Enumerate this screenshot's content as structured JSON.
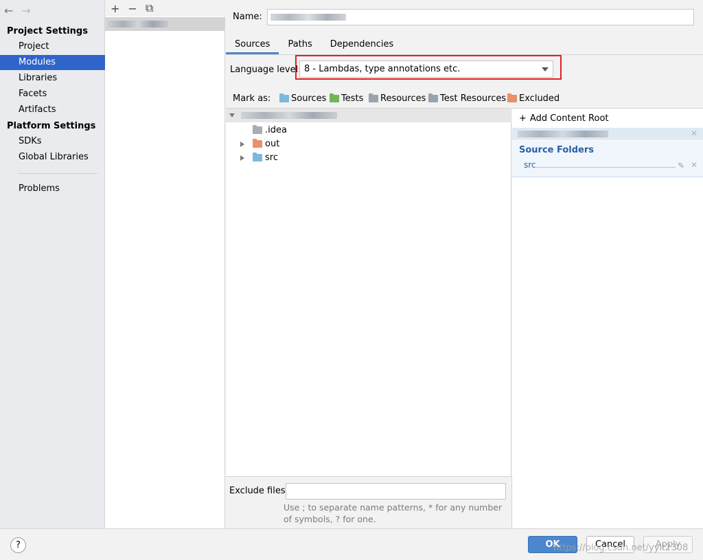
{
  "nav": {
    "back_icon": "←",
    "forward_icon": "→",
    "project_settings_title": "Project Settings",
    "project_settings_items": [
      "Project",
      "Modules",
      "Libraries",
      "Facets",
      "Artifacts"
    ],
    "platform_settings_title": "Platform Settings",
    "platform_settings_items": [
      "SDKs",
      "Global Libraries"
    ],
    "problems_label": "Problems",
    "selected_item": "Modules"
  },
  "module_list": {
    "add_icon": "+",
    "remove_icon": "−",
    "copy_icon": "⧉"
  },
  "module": {
    "name_label": "Name:"
  },
  "tabs": [
    "Sources",
    "Paths",
    "Dependencies"
  ],
  "active_tab": "Sources",
  "language_level": {
    "label": "Language level:",
    "value": "8 - Lambdas, type annotations etc."
  },
  "mark_as": {
    "label": "Mark as:",
    "items": [
      {
        "label": "Sources",
        "color": "#7cb8dc"
      },
      {
        "label": "Tests",
        "color": "#74b35a"
      },
      {
        "label": "Resources",
        "color": "#9aa3ad"
      },
      {
        "label": "Test Resources",
        "color": "#9aa3ad"
      },
      {
        "label": "Excluded",
        "color": "#e8916a"
      }
    ]
  },
  "tree": {
    "children": [
      {
        "name": ".idea",
        "folder_color": "#a8adb3"
      },
      {
        "name": "out",
        "folder_color": "#e8916a"
      },
      {
        "name": "src",
        "folder_color": "#7cb8dc"
      }
    ]
  },
  "content_root": {
    "add_label": "Add Content Root",
    "source_folders_title": "Source Folders",
    "source_folders": [
      "src"
    ],
    "remove_icon": "✕",
    "edit_icon": "✎"
  },
  "exclude": {
    "label": "Exclude files:",
    "hint": "Use ; to separate name patterns, * for any number of symbols, ? for one."
  },
  "footer": {
    "help_label": "?",
    "ok_label": "OK",
    "cancel_label": "Cancel",
    "apply_label": "Apply",
    "watermark": "https://blog.csdn.net/yylt2308"
  }
}
